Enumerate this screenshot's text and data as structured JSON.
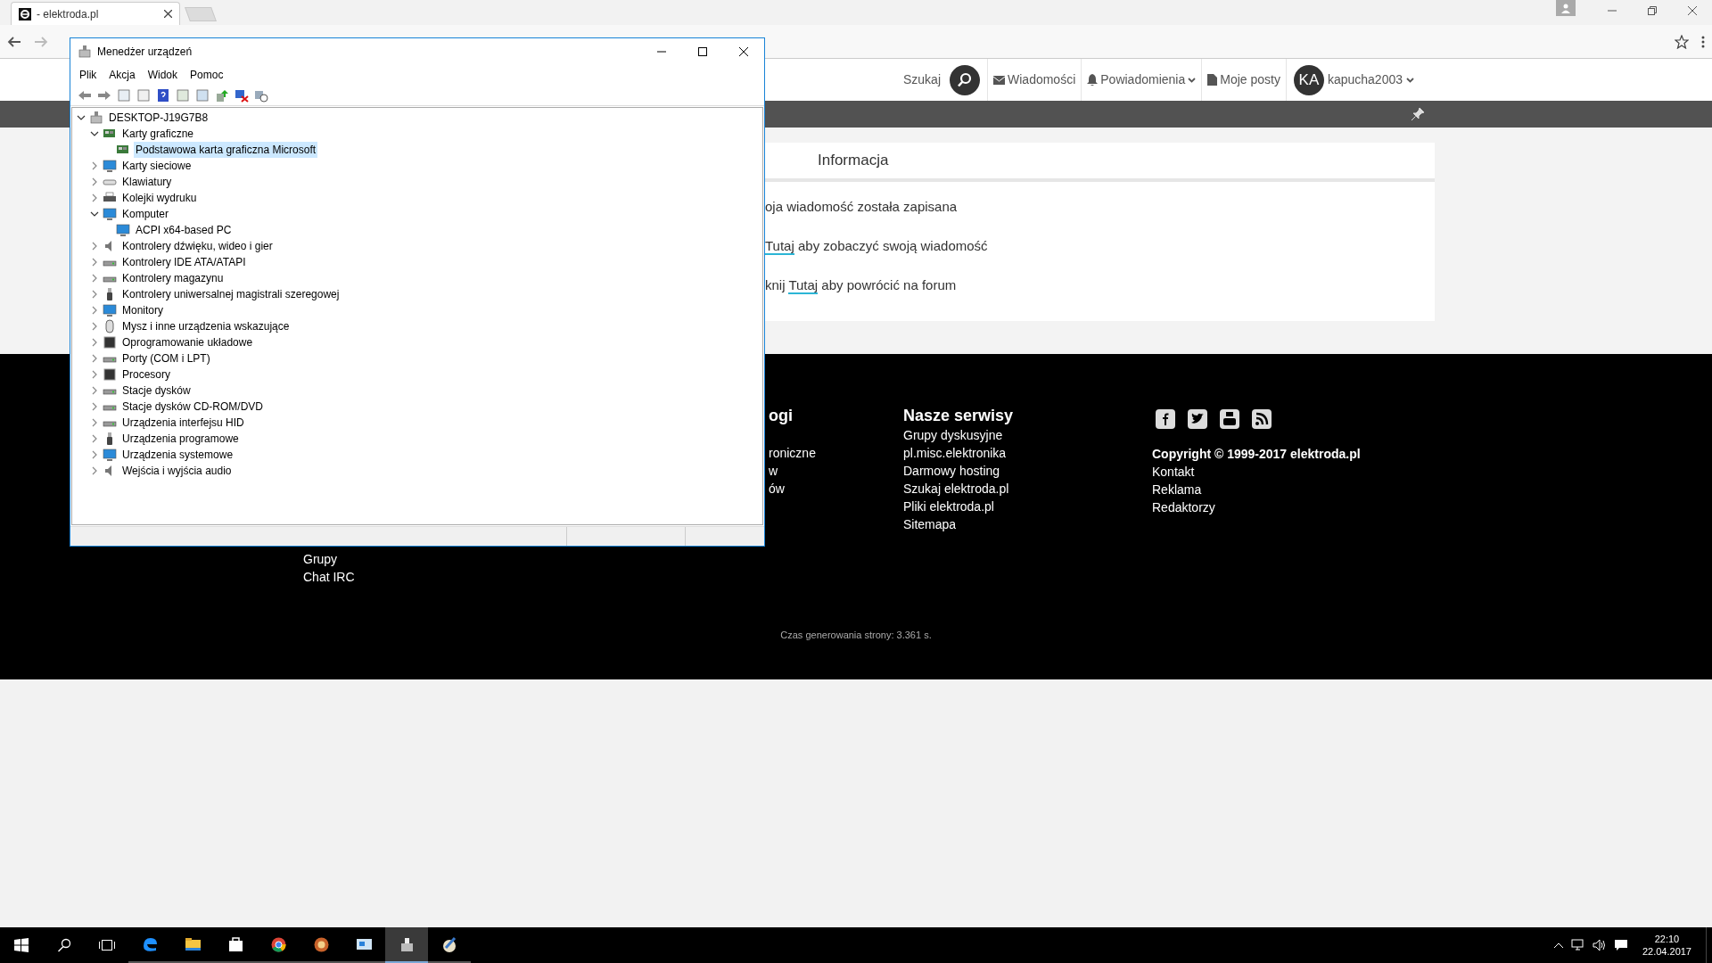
{
  "browser": {
    "tab_title": "- elektroda.pl"
  },
  "site": {
    "nav": [
      {
        "kind": "search",
        "label": "Szukaj"
      },
      {
        "kind": "messages",
        "label": "Wiadomości"
      },
      {
        "kind": "notifications",
        "label": "Powiadomienia"
      },
      {
        "kind": "posts",
        "label": "Moje posty"
      },
      {
        "kind": "user",
        "avatar": "KA",
        "label": "kapucha2003"
      }
    ],
    "info": {
      "title": "Informacja",
      "lines": [
        {
          "after": "oja wiadomość została zapisana"
        },
        {
          "link": "Tutaj",
          "after": " aby zobaczyć swoją wiadomość"
        },
        {
          "before": "knij ",
          "link": "Tutaj",
          "after": " aby powrócić na forum"
        }
      ]
    },
    "footer": {
      "col_left": [
        "Grupy",
        "Chat IRC"
      ],
      "col_cut": {
        "heading": "ogi",
        "items": [
          "roniczne",
          "w",
          "ów"
        ]
      },
      "services": {
        "heading": "Nasze serwisy",
        "items": [
          "Grupy dyskusyjne",
          "pl.misc.elektronika",
          "Darmowy hosting",
          "Szukaj elektroda.pl",
          "Pliki elektroda.pl",
          "Sitemapa"
        ]
      },
      "copyright": "Copyright © 1999-2017 elektroda.pl",
      "links": [
        "Kontakt",
        "Reklama",
        "Redaktorzy"
      ],
      "generated": "Czas generowania strony: 3.361 s."
    }
  },
  "device_manager": {
    "title": "Menedżer urządzeń",
    "menu": [
      "Plik",
      "Akcja",
      "Widok",
      "Pomoc"
    ],
    "tree": {
      "label": "DESKTOP-J19G7B8",
      "expanded": true,
      "children": [
        {
          "label": "Karty graficzne",
          "expanded": true,
          "children": [
            {
              "label": "Podstawowa karta graficzna Microsoft",
              "selected": true
            }
          ]
        },
        {
          "label": "Karty sieciowe",
          "expanded": false
        },
        {
          "label": "Klawiatury",
          "expanded": false
        },
        {
          "label": "Kolejki wydruku",
          "expanded": false
        },
        {
          "label": "Komputer",
          "expanded": true,
          "children": [
            {
              "label": "ACPI x64-based PC",
              "selected": false
            }
          ]
        },
        {
          "label": "Kontrolery dźwięku, wideo i gier",
          "expanded": false
        },
        {
          "label": "Kontrolery IDE ATA/ATAPI",
          "expanded": false
        },
        {
          "label": "Kontrolery magazynu",
          "expanded": false
        },
        {
          "label": "Kontrolery uniwersalnej magistrali szeregowej",
          "expanded": false
        },
        {
          "label": "Monitory",
          "expanded": false
        },
        {
          "label": "Mysz i inne urządzenia wskazujące",
          "expanded": false
        },
        {
          "label": "Oprogramowanie układowe",
          "expanded": false
        },
        {
          "label": "Porty (COM i LPT)",
          "expanded": false
        },
        {
          "label": "Procesory",
          "expanded": false
        },
        {
          "label": "Stacje dysków",
          "expanded": false
        },
        {
          "label": "Stacje dysków CD-ROM/DVD",
          "expanded": false
        },
        {
          "label": "Urządzenia interfejsu HID",
          "expanded": false
        },
        {
          "label": "Urządzenia programowe",
          "expanded": false
        },
        {
          "label": "Urządzenia systemowe",
          "expanded": false
        },
        {
          "label": "Wejścia i wyjścia audio",
          "expanded": false
        }
      ]
    }
  },
  "taskbar": {
    "apps": [
      {
        "kind": "edge",
        "active": false
      },
      {
        "kind": "folder",
        "active": false
      },
      {
        "kind": "store",
        "active": false
      },
      {
        "kind": "chrome",
        "active": false
      },
      {
        "kind": "paint",
        "active": false
      },
      {
        "kind": "monitor",
        "active": false
      },
      {
        "kind": "devmgr",
        "active": true
      },
      {
        "kind": "brush",
        "active": false
      }
    ],
    "time": "22:10",
    "date": "22.04.2017"
  }
}
